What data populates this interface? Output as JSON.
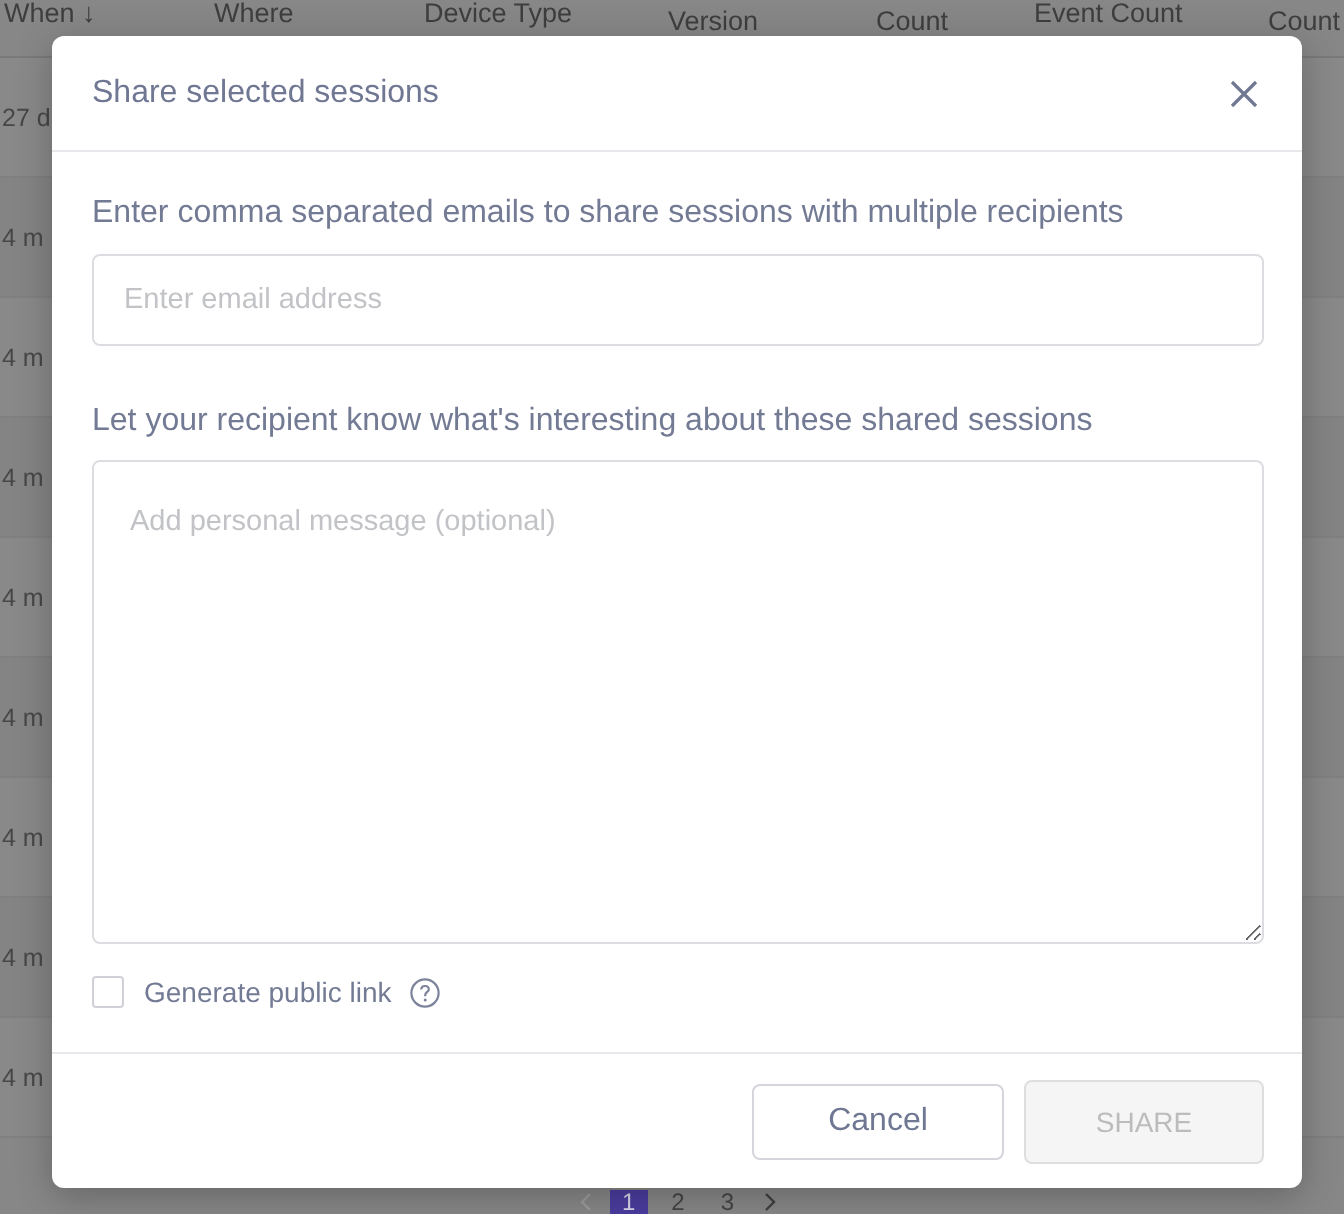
{
  "table": {
    "columns": [
      {
        "label": "When ↓"
      },
      {
        "label": "Where"
      },
      {
        "label": "Device Type"
      },
      {
        "label": "Version"
      },
      {
        "label": "Count"
      },
      {
        "label": "Event Count"
      },
      {
        "label": "Count"
      }
    ],
    "rows": [
      {
        "when": "27 d"
      },
      {
        "when": "4 m"
      },
      {
        "when": "4 m"
      },
      {
        "when": "4 m"
      },
      {
        "when": "4 m"
      },
      {
        "when": "4 m"
      },
      {
        "when": "4 m"
      },
      {
        "when": "4 m"
      },
      {
        "when": "4 m"
      }
    ]
  },
  "pagination": {
    "previous": {
      "disabled": true
    },
    "pages": [
      {
        "label": "1",
        "selected": true
      },
      {
        "label": "2",
        "selected": false
      },
      {
        "label": "3",
        "selected": false
      }
    ],
    "next": {
      "disabled": false
    }
  },
  "dialog": {
    "title": "Share selected sessions",
    "email_label": "Enter comma separated emails to share sessions with multiple recipients",
    "email_field": {
      "placeholder": "Enter email address"
    },
    "message_label": "Let your recipient know what's interesting about these shared sessions",
    "message_field": {
      "placeholder": "Add personal message (optional)"
    },
    "public_link": {
      "label": "Generate public link",
      "checked": false
    },
    "buttons": [
      {
        "label": "Cancel",
        "kind": "secondary",
        "disabled": false
      },
      {
        "label": "SHARE",
        "kind": "primary",
        "disabled": true
      }
    ]
  }
}
